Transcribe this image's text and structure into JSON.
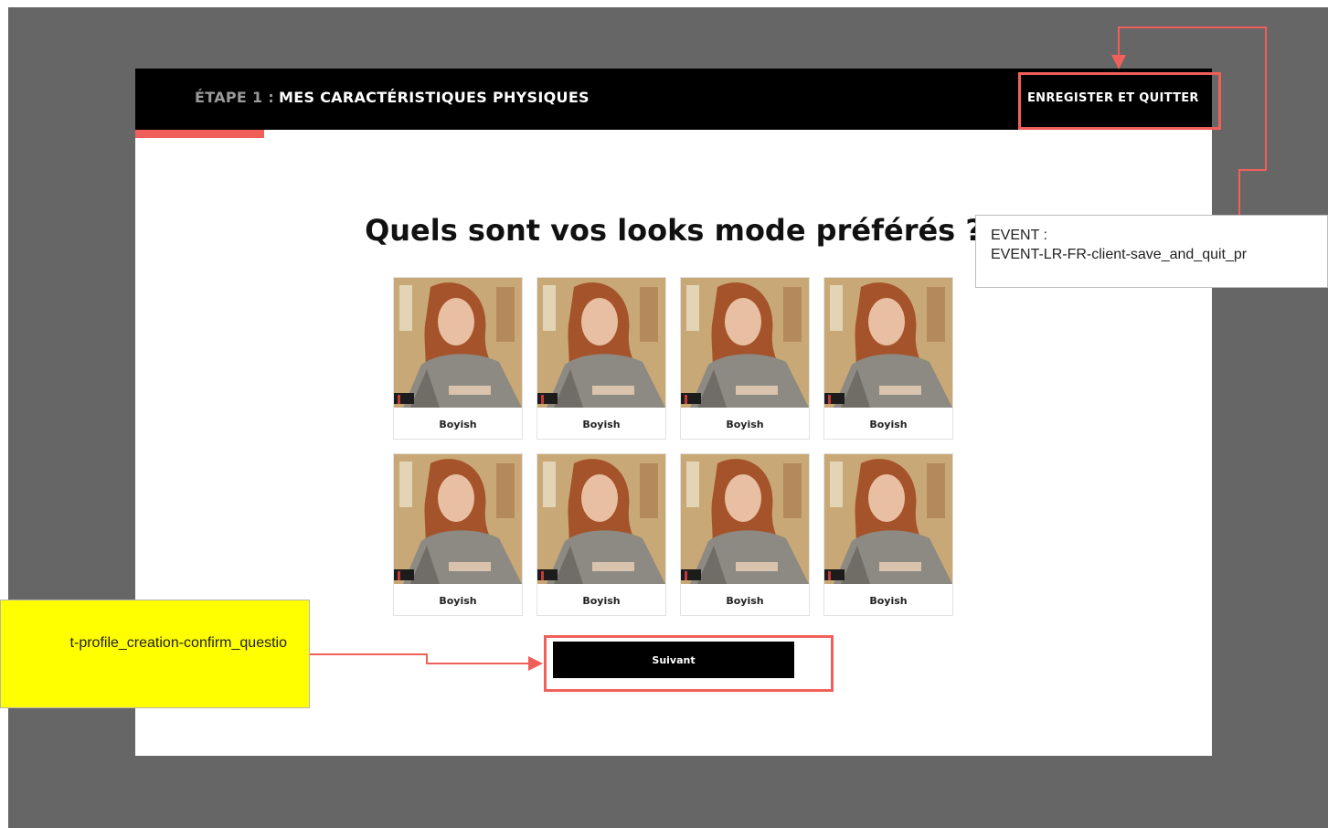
{
  "header": {
    "step_prefix": "ÉTAPE 1 :",
    "step_title": "MES CARACTÉRISTIQUES PHYSIQUES",
    "save_quit_label": "ENREGISTER ET QUITTER"
  },
  "progress": {
    "value": 0.12
  },
  "main": {
    "question": "Quels sont vos looks mode préférés ?",
    "looks": [
      {
        "label": "Boyish"
      },
      {
        "label": "Boyish"
      },
      {
        "label": "Boyish"
      },
      {
        "label": "Boyish"
      },
      {
        "label": "Boyish"
      },
      {
        "label": "Boyish"
      },
      {
        "label": "Boyish"
      },
      {
        "label": "Boyish"
      }
    ],
    "next_label": "Suivant"
  },
  "annotations": {
    "event_note": {
      "line1": "EVENT :",
      "line2": "EVENT-LR-FR-client-save_and_quit_pr"
    },
    "yellow_note": {
      "text": "t-profile_creation-confirm_questio"
    }
  },
  "colors": {
    "accent": "#f0605a",
    "background": "#666666",
    "topbar": "#000000",
    "note_yellow": "#ffff00"
  }
}
